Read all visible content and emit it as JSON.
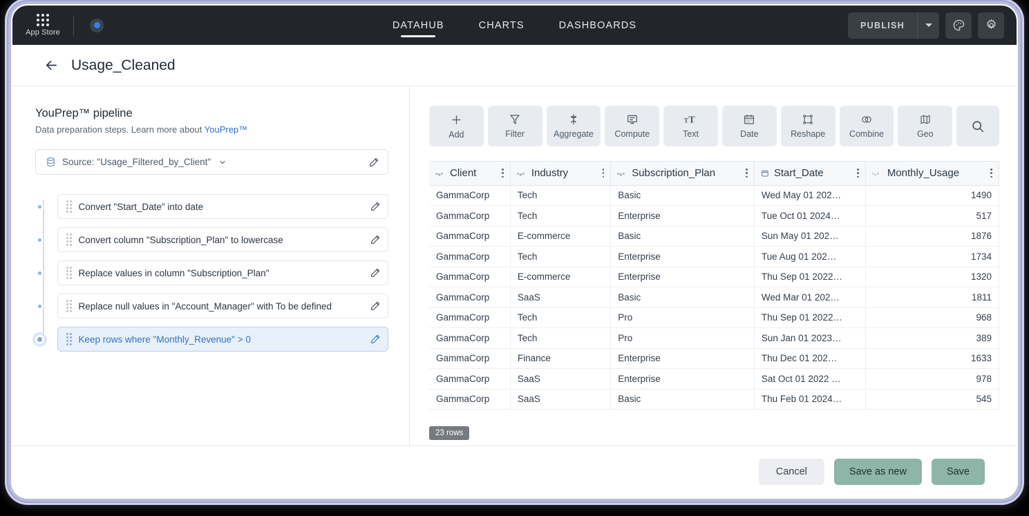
{
  "topbar": {
    "app_store_label": "App Store",
    "status_dot_color": "#2f80ed",
    "tabs": [
      {
        "label": "DATAHUB",
        "active": true
      },
      {
        "label": "CHARTS",
        "active": false
      },
      {
        "label": "DASHBOARDS",
        "active": false
      }
    ],
    "publish_label": "PUBLISH",
    "icons": [
      "palette-icon",
      "gear-icon"
    ]
  },
  "header": {
    "back_icon": "arrow-left-icon",
    "title": "Usage_Cleaned"
  },
  "left_panel": {
    "title": "YouPrep™ pipeline",
    "subtitle_prefix": "Data preparation steps. Learn more about ",
    "subtitle_link": "YouPrep™",
    "source": {
      "icon": "database-icon",
      "label": "Source: \"Usage_Filtered_by_Client\"",
      "caret": "chevron-down-icon",
      "edit_icon": "pencil-icon"
    },
    "steps": [
      {
        "label": "Convert \"Start_Date\" into date",
        "selected": false
      },
      {
        "label": "Convert column \"Subscription_Plan\" to lowercase",
        "selected": false
      },
      {
        "label": "Replace values in column \"Subscription_Plan\"",
        "selected": false
      },
      {
        "label": "Replace null values in \"Account_Manager\" with To be defined",
        "selected": false
      },
      {
        "label": "Keep rows where \"Monthly_Revenue\" > 0",
        "selected": true
      }
    ],
    "selected_color": "#3272c4"
  },
  "toolbar": [
    {
      "label": "Add",
      "icon": "plus-icon"
    },
    {
      "label": "Filter",
      "icon": "funnel-icon"
    },
    {
      "label": "Aggregate",
      "icon": "aggregate-icon"
    },
    {
      "label": "Compute",
      "icon": "compute-icon"
    },
    {
      "label": "Text",
      "icon": "text-size-icon"
    },
    {
      "label": "Date",
      "icon": "calendar-icon"
    },
    {
      "label": "Reshape",
      "icon": "reshape-icon"
    },
    {
      "label": "Combine",
      "icon": "combine-icon"
    },
    {
      "label": "Geo",
      "icon": "map-icon"
    },
    {
      "label": "",
      "icon": "search-icon"
    }
  ],
  "table": {
    "columns": [
      {
        "name": "Client",
        "type_icon": "abc",
        "align": "left"
      },
      {
        "name": "Industry",
        "type_icon": "abc",
        "align": "left"
      },
      {
        "name": "Subscription_Plan",
        "type_icon": "abc",
        "align": "left"
      },
      {
        "name": "Start_Date",
        "type_icon": "calendar",
        "align": "left"
      },
      {
        "name": "Monthly_Usage",
        "type_icon": "123",
        "align": "right"
      }
    ],
    "rows": [
      [
        "GammaCorp",
        "Tech",
        "Basic",
        "Wed May 01 202…",
        "1490"
      ],
      [
        "GammaCorp",
        "Tech",
        "Enterprise",
        "Tue Oct 01 2024…",
        "517"
      ],
      [
        "GammaCorp",
        "E-commerce",
        "Basic",
        "Sun May 01 202…",
        "1876"
      ],
      [
        "GammaCorp",
        "Tech",
        "Enterprise",
        "Tue Aug 01 202…",
        "1734"
      ],
      [
        "GammaCorp",
        "E-commerce",
        "Enterprise",
        "Thu Sep 01 2022…",
        "1320"
      ],
      [
        "GammaCorp",
        "SaaS",
        "Basic",
        "Wed Mar 01 202…",
        "1811"
      ],
      [
        "GammaCorp",
        "Tech",
        "Pro",
        "Thu Sep 01 2022…",
        "968"
      ],
      [
        "GammaCorp",
        "Tech",
        "Pro",
        "Sun Jan 01 2023…",
        "389"
      ],
      [
        "GammaCorp",
        "Finance",
        "Enterprise",
        "Thu Dec 01 202…",
        "1633"
      ],
      [
        "GammaCorp",
        "SaaS",
        "Enterprise",
        "Sat Oct 01 2022 …",
        "978"
      ],
      [
        "GammaCorp",
        "SaaS",
        "Basic",
        "Thu Feb 01 2024…",
        "545"
      ]
    ],
    "rows_badge": "23 rows"
  },
  "footer": {
    "cancel_label": "Cancel",
    "save_as_new_label": "Save as new",
    "save_label": "Save",
    "accent_green": "#8db5a8"
  }
}
